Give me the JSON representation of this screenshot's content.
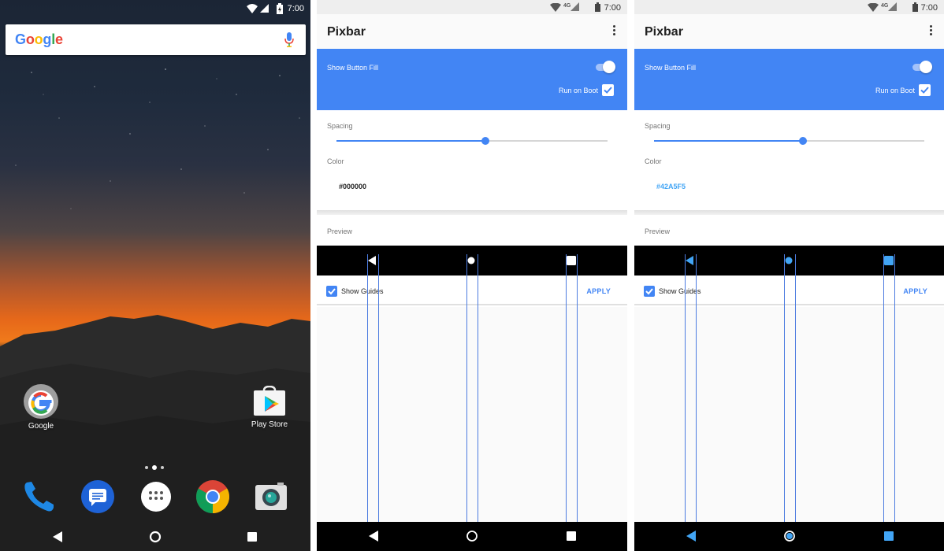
{
  "home": {
    "status_time": "7:00",
    "search_logo_letters": [
      {
        "ch": "G",
        "color": "#4285F4"
      },
      {
        "ch": "o",
        "color": "#EA4335"
      },
      {
        "ch": "o",
        "color": "#FBBC05"
      },
      {
        "ch": "g",
        "color": "#4285F4"
      },
      {
        "ch": "l",
        "color": "#34A853"
      },
      {
        "ch": "e",
        "color": "#EA4335"
      }
    ],
    "apps": {
      "google": "Google",
      "play_store": "Play Store"
    },
    "dock_icons": [
      "phone-icon",
      "messages-icon",
      "app-drawer-icon",
      "chrome-icon",
      "camera-icon"
    ]
  },
  "pixbar": {
    "status_time": "7:00",
    "title": "Pixbar",
    "show_button_fill": "Show Button Fill",
    "run_on_boot": "Run on Boot",
    "spacing_label": "Spacing",
    "spacing_value": 0.55,
    "color_label": "Color",
    "preview_label": "Preview",
    "show_guides": "Show Guides",
    "apply": "APPLY"
  },
  "screens": [
    {
      "color_value": "#000000",
      "color_text_color": "#212121",
      "nav_button_color": "#ffffff"
    },
    {
      "color_value": "#42A5F5",
      "color_text_color": "#42A5F5",
      "nav_button_color": "#42A5F5"
    }
  ],
  "colors": {
    "accent": "#4285F4",
    "header_blue": "#4285F4"
  }
}
